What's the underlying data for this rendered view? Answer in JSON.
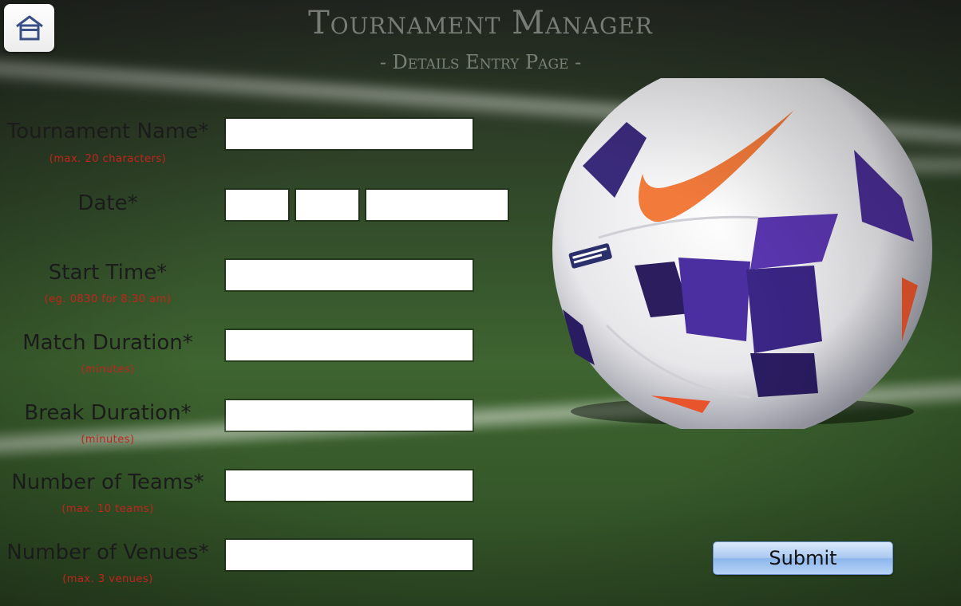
{
  "header": {
    "title": "Tournament Manager",
    "subtitle": "- Details Entry Page -",
    "home_icon": "home-icon"
  },
  "form": {
    "tournament_name": {
      "label": "Tournament Name*",
      "hint": "(max. 20 characters)",
      "value": ""
    },
    "date": {
      "label": "Date*",
      "day": "",
      "month": "",
      "year": ""
    },
    "start_time": {
      "label": "Start Time*",
      "hint": "(eg. 0830 for 8:30 am)",
      "value": ""
    },
    "match_duration": {
      "label": "Match Duration*",
      "hint": "(minutes)",
      "value": ""
    },
    "break_duration": {
      "label": "Break Duration*",
      "hint": "(minutes)",
      "value": ""
    },
    "number_of_teams": {
      "label": "Number of Teams*",
      "hint": "(max. 10 teams)",
      "value": ""
    },
    "number_of_venues": {
      "label": "Number of Venues*",
      "hint": "(max. 3 venues)",
      "value": ""
    }
  },
  "submit": {
    "label": "Submit"
  },
  "colors": {
    "hint": "#c4231c",
    "button_top": "#dbe9fb",
    "button_bottom": "#8cb6ec"
  }
}
